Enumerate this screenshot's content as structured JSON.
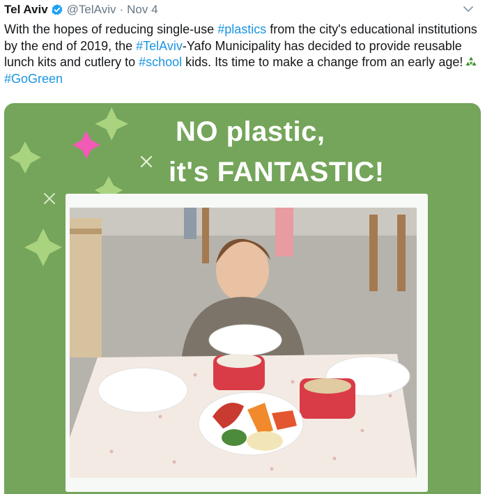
{
  "tweet": {
    "author_name": "Tel Aviv",
    "handle": "@TelAviv",
    "separator": "·",
    "date": "Nov 4",
    "text_parts": {
      "p1": "With the hopes of reducing single-use ",
      "tag_plastics": "#plastics",
      "p2": " from the city's educational institutions by the end of 2019, the ",
      "tag_telaviv": "#TelAviv",
      "p3": "-Yafo Municipality has decided to provide reusable lunch kits and cutlery to ",
      "tag_school": "#school",
      "p4": " kids. Its time to make a change from an early age!",
      "tag_gogreen": "#GoGreen"
    },
    "icons": {
      "verified": "verified-badge-icon",
      "caret": "chevron-down-icon",
      "recycle": "recycle-emoji-icon"
    }
  },
  "media": {
    "headline_line1": "NO plastic,",
    "headline_line2": "it's FANTASTIC!",
    "background_color": "#74a55a"
  },
  "colors": {
    "link": "#1b95e0",
    "secondary": "#657786",
    "verified": "#1da1f2"
  }
}
